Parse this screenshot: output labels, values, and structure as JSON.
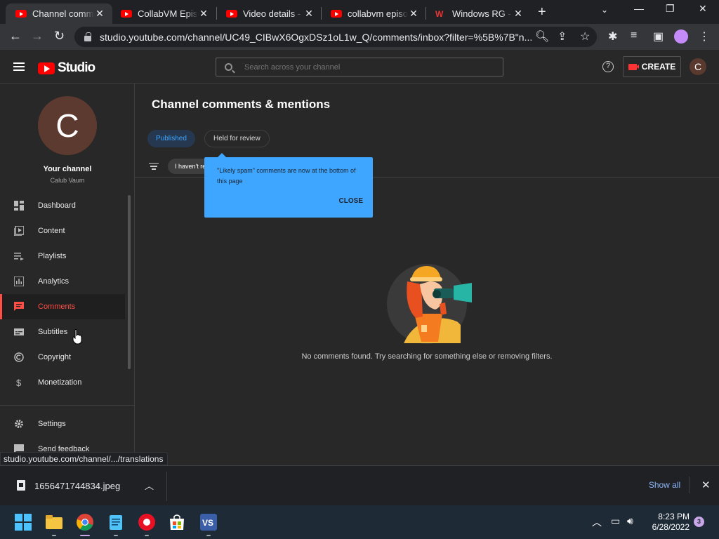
{
  "browser": {
    "tabs": [
      {
        "title": "Channel comme",
        "icon": "youtube-icon",
        "active": true
      },
      {
        "title": "CollabVM Episo",
        "icon": "youtube-icon"
      },
      {
        "title": "Video details - Y",
        "icon": "youtube-icon"
      },
      {
        "title": "collabvm episoc",
        "icon": "youtube-icon"
      },
      {
        "title": "Windows RG - J",
        "icon": "windows-rg-icon"
      }
    ],
    "url": "studio.youtube.com/channel/UC49_CIBwX6OgxDSz1oL1w_Q/comments/inbox?filter=%5B%7B\"n...",
    "status_url": "studio.youtube.com/channel/.../translations"
  },
  "studio": {
    "logo_text": "Studio",
    "search_placeholder": "Search across your channel",
    "help_glyph": "?",
    "create_label": "CREATE",
    "avatar_letter": "C"
  },
  "sidebar": {
    "avatar_letter": "C",
    "your_channel": "Your channel",
    "channel_name": "Calub Vaum",
    "items": [
      {
        "label": "Dashboard",
        "icon": "dashboard-icon"
      },
      {
        "label": "Content",
        "icon": "content-icon"
      },
      {
        "label": "Playlists",
        "icon": "playlists-icon"
      },
      {
        "label": "Analytics",
        "icon": "analytics-icon"
      },
      {
        "label": "Comments",
        "icon": "comments-icon",
        "active": true
      },
      {
        "label": "Subtitles",
        "icon": "subtitles-icon"
      },
      {
        "label": "Copyright",
        "icon": "copyright-icon"
      },
      {
        "label": "Monetization",
        "icon": "monetization-icon"
      }
    ],
    "bottom": [
      {
        "label": "Settings",
        "icon": "settings-icon"
      },
      {
        "label": "Send feedback",
        "icon": "feedback-icon"
      }
    ]
  },
  "main": {
    "title": "Channel comments & mentions",
    "tabs": [
      "Published",
      "Held for review"
    ],
    "filter_chip": "I haven't re",
    "tooltip": {
      "text": "\"Likely spam\" comments are now at the bottom of this page",
      "close": "CLOSE"
    },
    "empty_message": "No comments found. Try searching for something else or removing filters."
  },
  "downloads": {
    "file": "1656471744834.jpeg",
    "show_all": "Show all"
  },
  "taskbar": {
    "time": "8:23 PM",
    "date": "6/28/2022",
    "notifications": "3"
  },
  "colors": {
    "accent": "#3ea6ff",
    "active_nav": "#ff4e45",
    "youtube_red": "#ff0000"
  }
}
